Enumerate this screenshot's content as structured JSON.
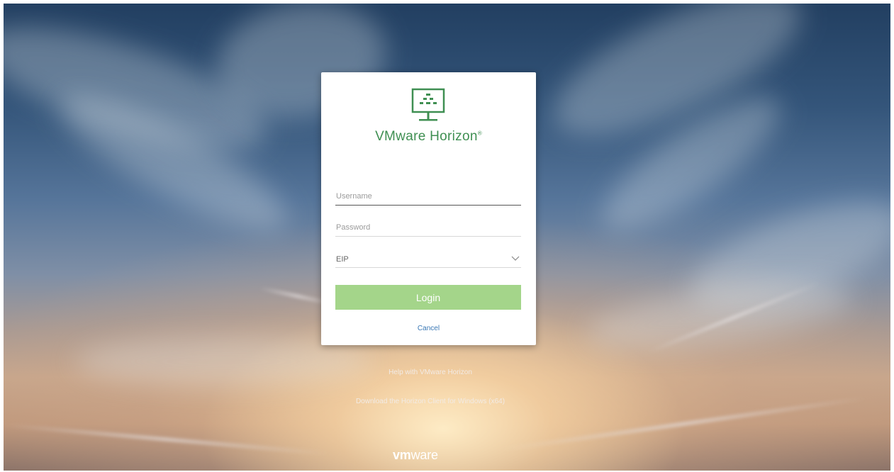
{
  "login_card": {
    "brand_name": "VMware Horizon",
    "brand_mark": "®",
    "logo_icon": "horizon-monitor-icon",
    "username": {
      "value": "",
      "placeholder": "Username"
    },
    "password": {
      "value": "",
      "placeholder": "Password"
    },
    "domain_select": {
      "selected": "EIP",
      "icon": "chevron-down-icon"
    },
    "login_label": "Login",
    "cancel_label": "Cancel"
  },
  "footer": {
    "help_link": "Help with VMware Horizon",
    "download_link": "Download the Horizon Client for Windows (x64)",
    "vendor_logo": {
      "bold_part": "vm",
      "rest": "ware"
    }
  },
  "colors": {
    "brand_green": "#3f8f52",
    "login_button": "#a4d58a",
    "cancel_link": "#3a78b5"
  }
}
